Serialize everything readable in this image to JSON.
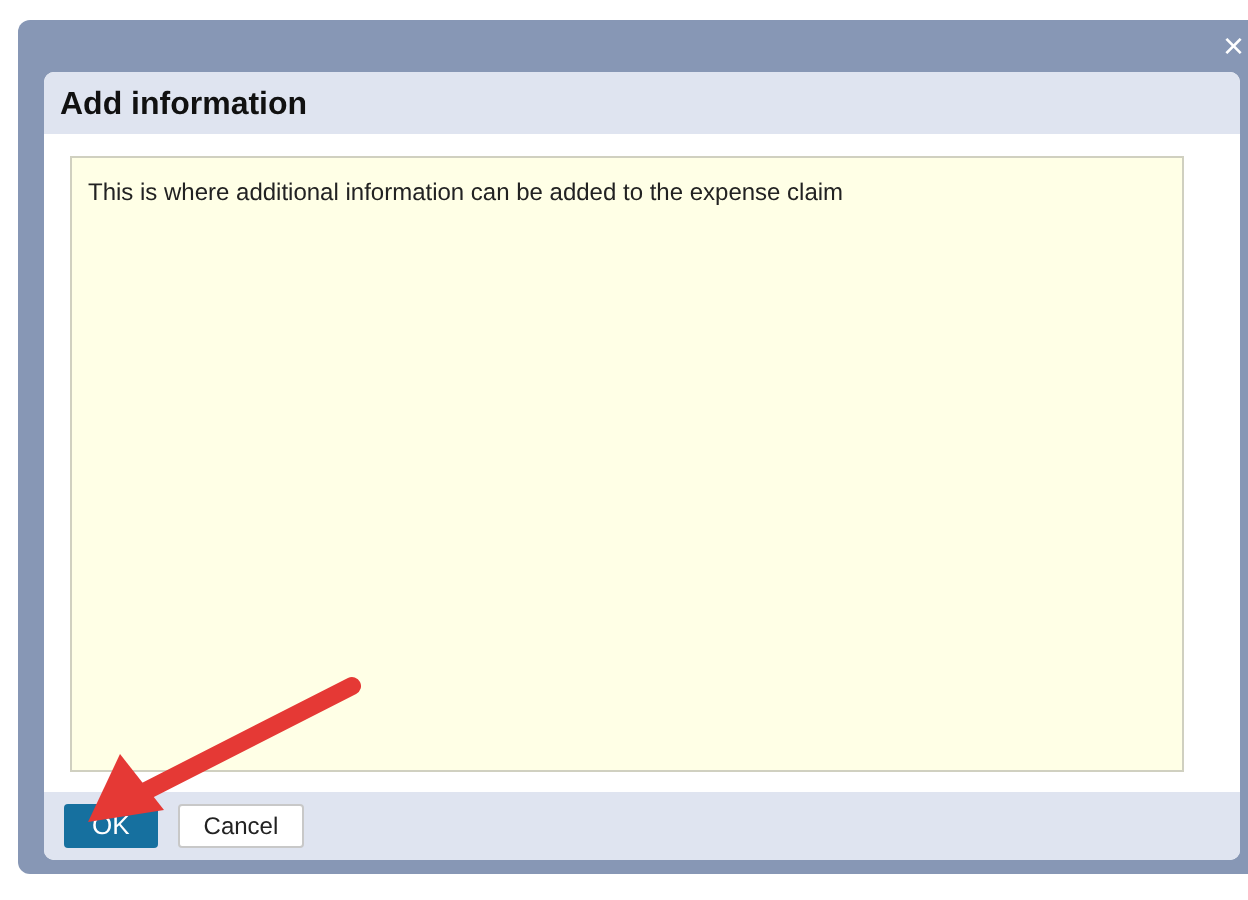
{
  "dialog": {
    "title": "Add information",
    "close": "×"
  },
  "textarea": {
    "value": "This is where additional information can be added to the expense claim"
  },
  "buttons": [
    {
      "label": "OK",
      "kind": "primary"
    },
    {
      "label": "Cancel",
      "kind": "secondary"
    }
  ]
}
